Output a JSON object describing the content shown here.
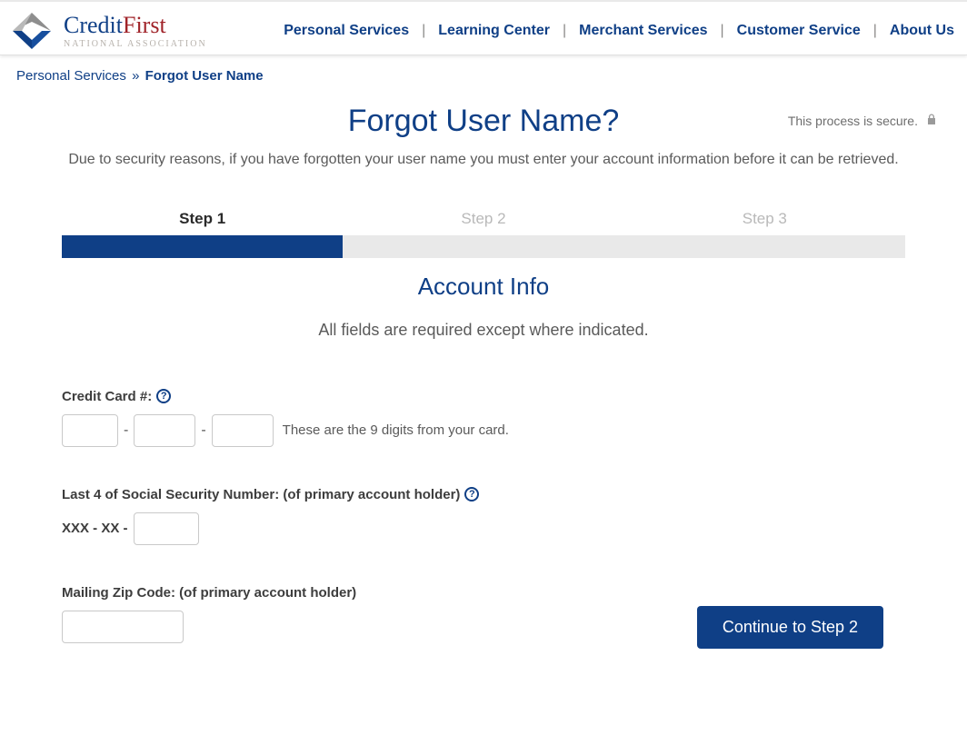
{
  "brand": {
    "word1": "Credit",
    "word2": "First",
    "tagline": "NATIONAL ASSOCIATION"
  },
  "nav": {
    "items": [
      "Personal Services",
      "Learning Center",
      "Merchant Services",
      "Customer Service",
      "About Us"
    ]
  },
  "breadcrumb": {
    "parent": "Personal Services",
    "current": "Forgot User Name"
  },
  "page": {
    "title": "Forgot User Name?",
    "secure_text": "This process is secure.",
    "intro": "Due to security reasons, if you have forgotten your user name you must enter your account information before it can be retrieved."
  },
  "steps": {
    "items": [
      "Step 1",
      "Step 2",
      "Step 3"
    ],
    "active_index": 0
  },
  "section": {
    "title": "Account Info",
    "subtitle": "All fields are required except where indicated."
  },
  "form": {
    "cc_label": "Credit Card #:",
    "cc_hint": "These are the 9 digits from your card.",
    "ssn_label": "Last 4 of Social Security Number: (of primary account holder)",
    "ssn_prefix": "XXX - XX -",
    "zip_label": "Mailing Zip Code: (of primary account holder)",
    "submit_label": "Continue to Step 2",
    "help_glyph": "?"
  }
}
